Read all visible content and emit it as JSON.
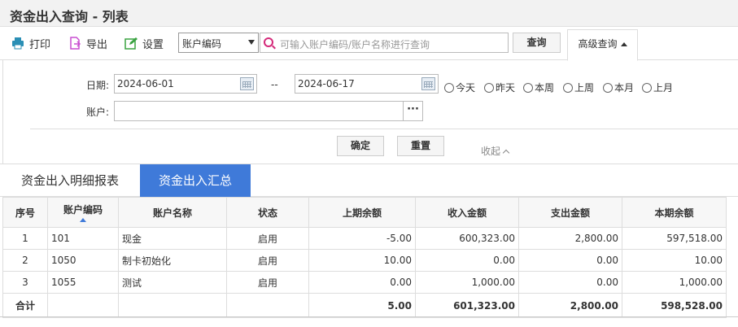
{
  "title": "资金出入查询 - 列表",
  "toolbar": {
    "print": "打印",
    "export": "导出",
    "settings": "设置",
    "field_select": "账户编码",
    "search_placeholder": "可输入账户编码/账户名称进行查询",
    "query": "查询",
    "advanced": "高级查询"
  },
  "filter": {
    "date_label": "日期:",
    "date_from": "2024-06-01",
    "date_to": "2024-06-17",
    "range_sep": "--",
    "account_label": "账户:",
    "account_value": "",
    "picker": "···",
    "periods": [
      "今天",
      "昨天",
      "本周",
      "上周",
      "本月",
      "上月"
    ],
    "confirm": "确定",
    "reset": "重置",
    "collapse": "收起"
  },
  "tabs": [
    "资金出入明细报表",
    "资金出入汇总"
  ],
  "active_tab": 1,
  "table": {
    "columns": [
      "序号",
      "账户编码",
      "账户名称",
      "状态",
      "上期余额",
      "收入金额",
      "支出金额",
      "本期余额"
    ],
    "rows": [
      [
        "1",
        "101",
        "现金",
        "启用",
        "-5.00",
        "600,323.00",
        "2,800.00",
        "597,518.00"
      ],
      [
        "2",
        "1050",
        "制卡初始化",
        "启用",
        "10.00",
        "0.00",
        "0.00",
        "10.00"
      ],
      [
        "3",
        "1055",
        "测试",
        "启用",
        "0.00",
        "1,000.00",
        "0.00",
        "1,000.00"
      ]
    ],
    "total": [
      "合计",
      "",
      "",
      "",
      "5.00",
      "601,323.00",
      "2,800.00",
      "598,528.00"
    ]
  },
  "colors": {
    "accent": "#3f7ad9",
    "search_icon": "#d42a7a",
    "print_icon": "#2a8fb5",
    "export_icon": "#c94fd0",
    "settings_icon": "#3aa341"
  }
}
